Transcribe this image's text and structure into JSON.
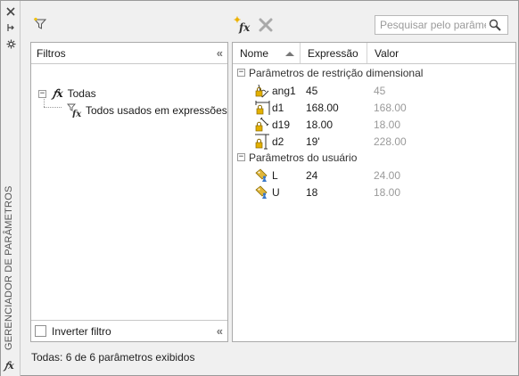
{
  "window": {
    "vertical_title": "GERENCIADOR DE PARÂMETROS"
  },
  "icons": {
    "strip": [
      "close-icon",
      "auto-hide-icon",
      "properties-icon"
    ],
    "strip_bottom": "fx-icon",
    "toolbar": [
      "new-filter-icon",
      "new-user-parameter-icon",
      "delete-icon",
      "search-icon"
    ]
  },
  "toolbar": {
    "search_placeholder": "Pesquisar pelo parâmetro",
    "fx_glyph": "fx"
  },
  "filters": {
    "header": "Filtros",
    "collapse_glyph": "«",
    "tree": [
      {
        "label": "Todas",
        "expanded": true
      },
      {
        "label": "Todos usados em expressões"
      }
    ],
    "invert_label": "Inverter filtro",
    "invert_checked": false
  },
  "table": {
    "columns": [
      "Nome",
      "Expressão",
      "Valor"
    ],
    "groups": [
      {
        "label": "Parâmetros de restrição dimensional",
        "rows": [
          {
            "name": "ang1",
            "expr": "45",
            "value": "45",
            "icon": "angular-dimension-icon"
          },
          {
            "name": "d1",
            "expr": "168.00",
            "value": "168.00",
            "icon": "horizontal-dimension-icon"
          },
          {
            "name": "d19",
            "expr": "18.00",
            "value": "18.00",
            "icon": "aligned-dimension-icon"
          },
          {
            "name": "d2",
            "expr": "19'",
            "value": "228.00",
            "icon": "vertical-dimension-icon"
          }
        ]
      },
      {
        "label": "Parâmetros do usuário",
        "rows": [
          {
            "name": "L",
            "expr": "24",
            "value": "24.00",
            "icon": "user-parameter-icon"
          },
          {
            "name": "U",
            "expr": "18",
            "value": "18.00",
            "icon": "user-parameter-icon"
          }
        ]
      }
    ]
  },
  "status": "Todas: 6 de 6 parâmetros exibidos",
  "colors": {
    "lock": "#d6a400",
    "user_param": "#e0b73a",
    "user_param_badge": "#3a78c9",
    "delete_disabled": "#a9a9a9",
    "muted_text": "#9a9a9a"
  }
}
